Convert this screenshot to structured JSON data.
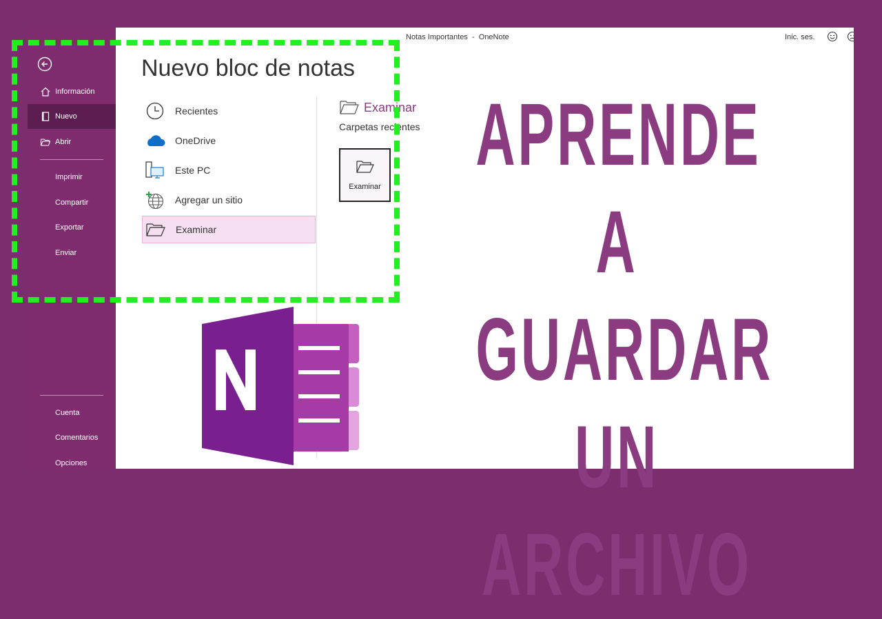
{
  "window": {
    "title": "Notas Importantes  -  OneNote",
    "signin_label": "Inic. ses.",
    "help_label": "?"
  },
  "sidebar": {
    "items": [
      {
        "label": "Información",
        "icon": "home-icon"
      },
      {
        "label": "Nuevo",
        "icon": "new-notebook-icon"
      },
      {
        "label": "Abrir",
        "icon": "folder-open-icon"
      },
      {
        "label": "Imprimir"
      },
      {
        "label": "Compartir"
      },
      {
        "label": "Exportar"
      },
      {
        "label": "Enviar"
      },
      {
        "label": "Cuenta"
      },
      {
        "label": "Comentarios"
      },
      {
        "label": "Opciones"
      }
    ]
  },
  "main": {
    "title": "Nuevo bloc de notas",
    "locations": [
      {
        "label": "Recientes",
        "icon": "clock-icon"
      },
      {
        "label": "OneDrive",
        "icon": "cloud-icon"
      },
      {
        "label": "Este PC",
        "icon": "computer-icon"
      },
      {
        "label": "Agregar un sitio",
        "icon": "globe-add-icon"
      },
      {
        "label": "Examinar",
        "icon": "folder-open-icon"
      }
    ],
    "browse": {
      "heading": "Examinar",
      "recent_folders_label": "Carpetas recientes",
      "tile_label": "Examinar"
    }
  },
  "overlay": {
    "headline_lines": [
      "APRENDE A",
      "GUARDAR UN",
      "ARCHIVO"
    ],
    "headline_color": "#8b3b80",
    "highlight_color": "#22ee22"
  },
  "colors": {
    "frame": "#7b2d6e",
    "sidebar": "#7f2c6f",
    "sidebar_active": "#5c1d50",
    "accent": "#8b3b80"
  }
}
